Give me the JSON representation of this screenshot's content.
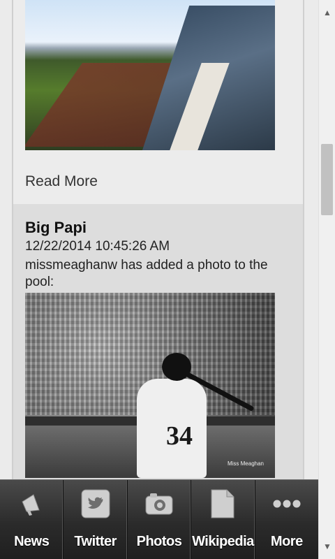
{
  "feed": {
    "item1": {
      "read_more": "Read More"
    },
    "item2": {
      "title": "Big Papi",
      "date": "12/22/2014 10:45:26 AM",
      "text": "missmeaghanw has added a photo to the pool:",
      "photo": {
        "jersey_number": "34",
        "signature": "Miss Meaghan"
      }
    }
  },
  "tabs": [
    {
      "label": "News",
      "icon": "megaphone-icon"
    },
    {
      "label": "Twitter",
      "icon": "twitter-bird-icon"
    },
    {
      "label": "Photos",
      "icon": "camera-icon"
    },
    {
      "label": "Wikipedia",
      "icon": "document-icon"
    },
    {
      "label": "More",
      "icon": "ellipsis-icon"
    }
  ],
  "scrollbar": {
    "up_arrow": "▲",
    "down_arrow": "▼"
  }
}
